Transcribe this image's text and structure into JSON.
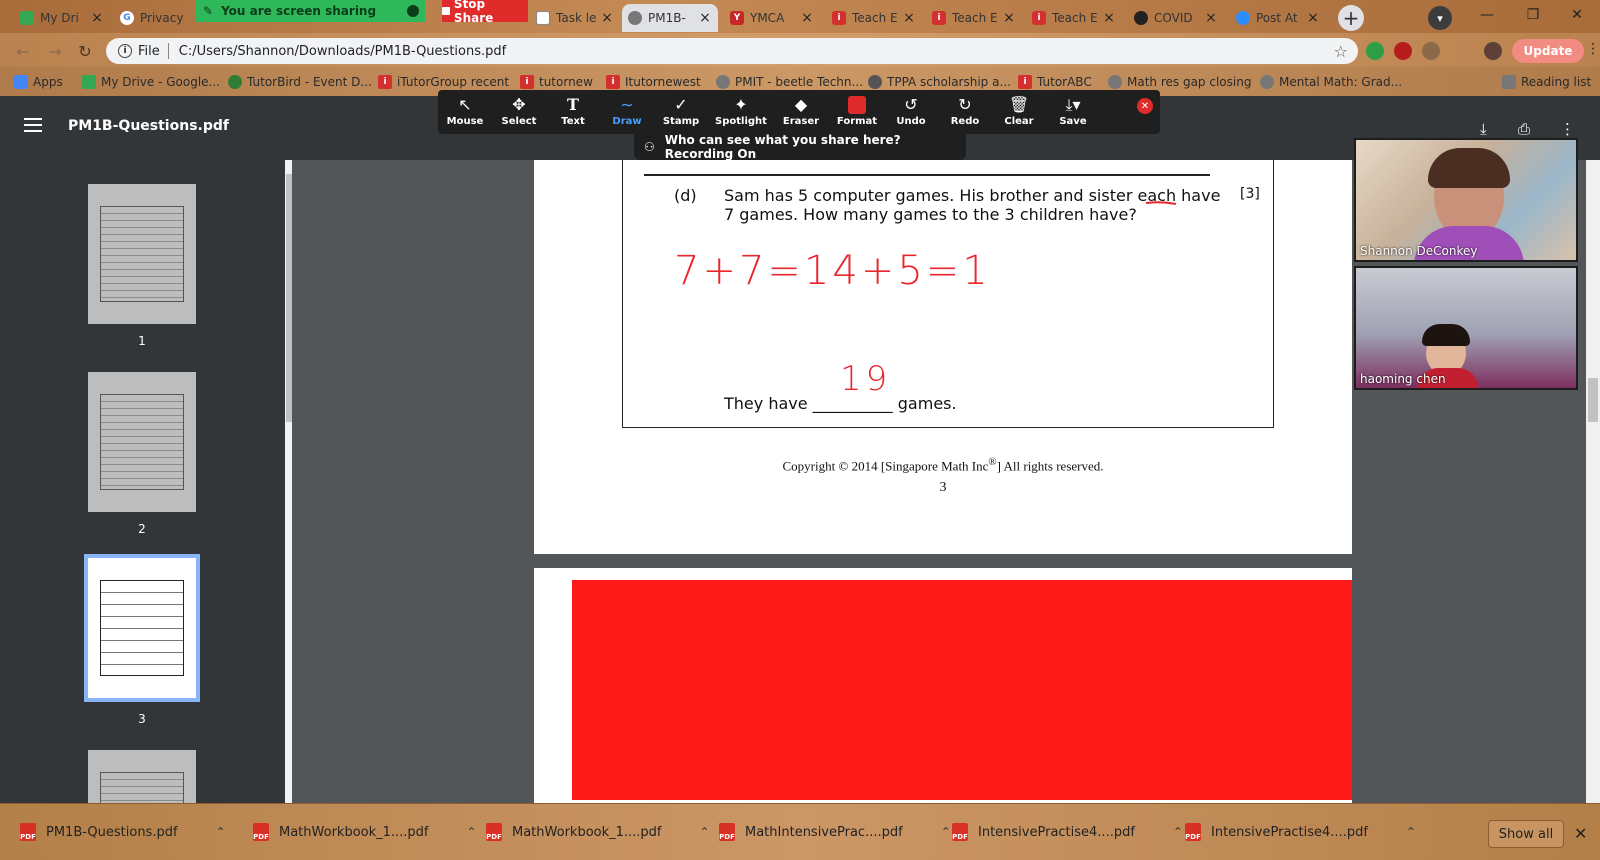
{
  "tabs": [
    {
      "label": "My Dri",
      "icon": "drive-icon",
      "color": "#34a853"
    },
    {
      "label": "Privacy",
      "icon": "google-icon",
      "color": "#4285f4"
    },
    {
      "label": "Task le",
      "icon": "page-icon",
      "color": "#888888"
    },
    {
      "label": "PM1B-",
      "icon": "globe-icon",
      "color": "#777777"
    },
    {
      "label": "YMCA",
      "icon": "ymca-icon",
      "color": "#c62828"
    },
    {
      "label": "Teach E",
      "icon": "tutor-icon",
      "color": "#d32f2f"
    },
    {
      "label": "Teach E",
      "icon": "tutor-icon",
      "color": "#d32f2f"
    },
    {
      "label": "Teach E",
      "icon": "tutor-icon",
      "color": "#d32f2f"
    },
    {
      "label": "COVID",
      "icon": "shield-icon",
      "color": "#222222"
    },
    {
      "label": "Post At",
      "icon": "zoom-icon",
      "color": "#2d8cff"
    }
  ],
  "screen_share": {
    "status": "You are screen sharing",
    "stop_label": "Stop Share"
  },
  "address": {
    "scheme_label": "File",
    "url": "C:/Users/Shannon/Downloads/PM1B-Questions.pdf"
  },
  "update_label": "Update",
  "bookmarks": [
    {
      "label": "Apps",
      "color": "#4285f4"
    },
    {
      "label": "My Drive - Google...",
      "color": "#34a853"
    },
    {
      "label": "TutorBird - Event D...",
      "color": "#2e7d32"
    },
    {
      "label": "iTutorGroup recent",
      "color": "#d32f2f"
    },
    {
      "label": "tutornew",
      "color": "#d32f2f"
    },
    {
      "label": "Itutornewest",
      "color": "#d32f2f"
    },
    {
      "label": "PMIT - beetle Techn...",
      "color": "#777777"
    },
    {
      "label": "TPPA scholarship a...",
      "color": "#555555"
    },
    {
      "label": "TutorABC",
      "color": "#d32f2f"
    },
    {
      "label": "Math res gap closing",
      "color": "#777777"
    },
    {
      "label": "Mental Math: Grad...",
      "color": "#777777"
    },
    {
      "label": "Reading list",
      "color": "#777777"
    }
  ],
  "pdf": {
    "title": "PM1B-Questions.pdf",
    "thumbnails": [
      {
        "page": "1"
      },
      {
        "page": "2"
      },
      {
        "page": "3"
      }
    ],
    "question": {
      "label": "(d)",
      "text": "Sam has 5 computer games. His brother and sister each have 7 games. How many games to the 3 children have?",
      "marks": "[3]",
      "answer_prefix": "They have",
      "answer_blank": "__________",
      "answer_suffix": "games."
    },
    "handwriting": {
      "work": "7+7=14+5=19",
      "answer": "19",
      "color": "#e8262b"
    },
    "copyright": "Copyright © 2014 [Singapore Math Inc",
    "copyright_reg": "®",
    "copyright_end": "] All rights reserved.",
    "page_number": "3"
  },
  "zoom_toolbar": {
    "tools": [
      {
        "label": "Mouse",
        "icon": "↖"
      },
      {
        "label": "Select",
        "icon": "✥"
      },
      {
        "label": "Text",
        "icon": "T"
      },
      {
        "label": "Draw",
        "icon": "∼"
      },
      {
        "label": "Stamp",
        "icon": "✓"
      },
      {
        "label": "Spotlight",
        "icon": "✦"
      },
      {
        "label": "Eraser",
        "icon": "◆"
      },
      {
        "label": "Format",
        "icon": ""
      },
      {
        "label": "Undo",
        "icon": "↺"
      },
      {
        "label": "Redo",
        "icon": "↻"
      },
      {
        "label": "Clear",
        "icon": "🗑"
      },
      {
        "label": "Save",
        "icon": "⤓"
      }
    ],
    "active": "Draw",
    "banner": "Who can see what you share here? Recording On"
  },
  "participants": [
    {
      "name": "Shannon DeConkey"
    },
    {
      "name": "haoming   chen"
    }
  ],
  "downloads": [
    {
      "name": "PM1B-Questions.pdf"
    },
    {
      "name": "MathWorkbook_1....pdf"
    },
    {
      "name": "MathWorkbook_1....pdf"
    },
    {
      "name": "MathIntensivePrac....pdf"
    },
    {
      "name": "IntensivePractise4....pdf"
    },
    {
      "name": "IntensivePractise4....pdf"
    }
  ],
  "show_all_label": "Show all"
}
